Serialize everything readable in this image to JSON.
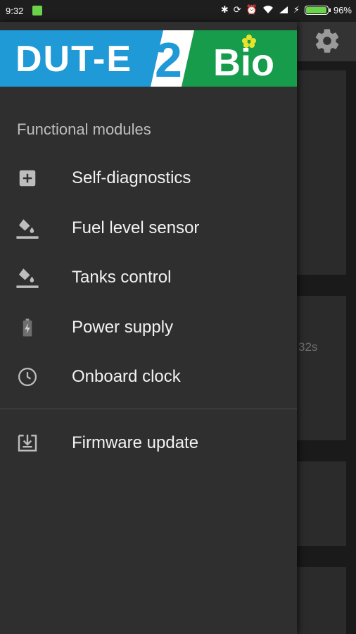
{
  "status_bar": {
    "time": "9:32",
    "battery_percent": 96,
    "battery_label": "96%"
  },
  "background": {
    "partial_text": "32s"
  },
  "logo": {
    "left": "DUT-E",
    "middle": "2",
    "right": "Bio",
    "colors": {
      "blue": "#1f9ad6",
      "green": "#169c4b",
      "flower": "#e8e22a"
    }
  },
  "drawer": {
    "section_title": "Functional modules",
    "items": [
      {
        "label": "Self-diagnostics",
        "icon": "plus-box-icon"
      },
      {
        "label": "Fuel level sensor",
        "icon": "paint-bucket-icon"
      },
      {
        "label": "Tanks control",
        "icon": "paint-bucket-icon"
      },
      {
        "label": "Power supply",
        "icon": "battery-charging-icon"
      },
      {
        "label": "Onboard clock",
        "icon": "clock-icon"
      }
    ],
    "footer_items": [
      {
        "label": "Firmware update",
        "icon": "download-icon"
      }
    ]
  }
}
